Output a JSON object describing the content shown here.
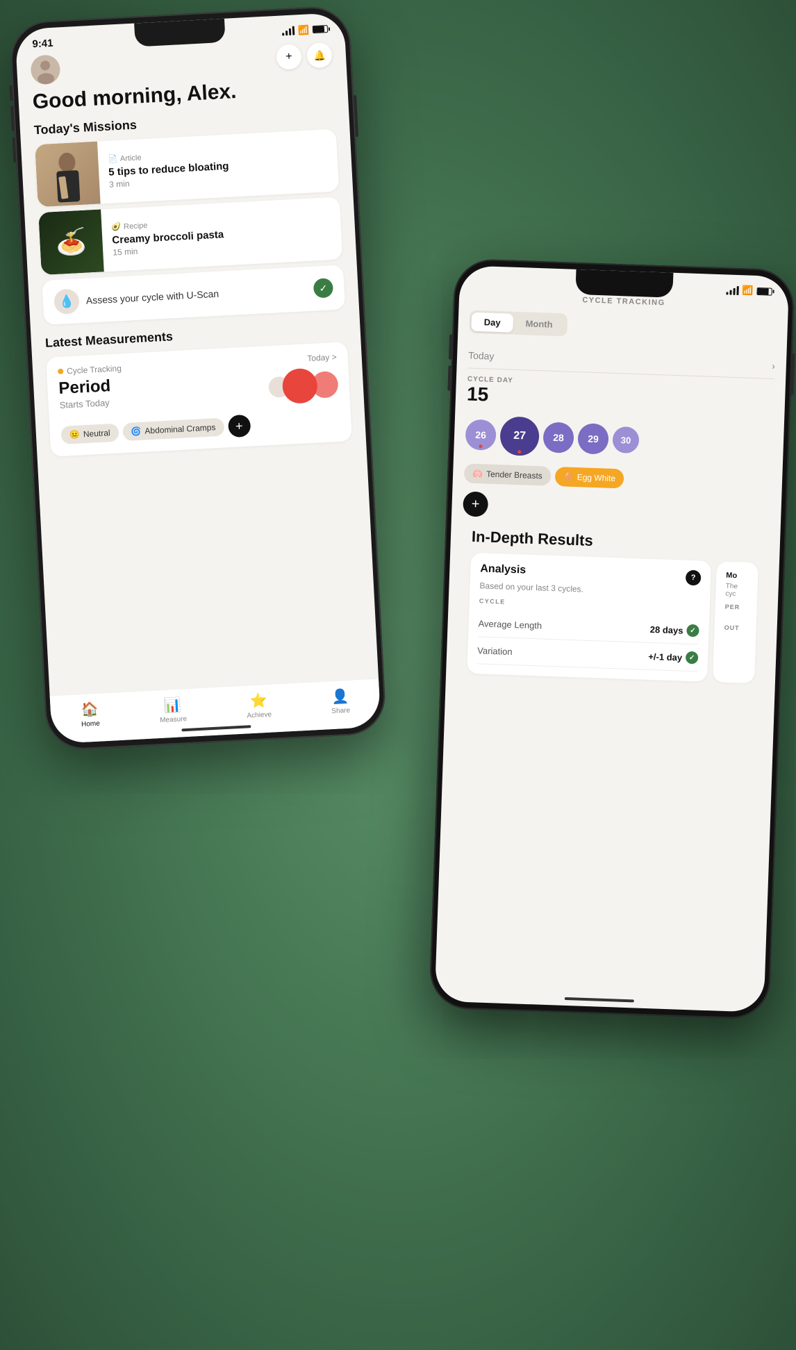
{
  "phone1": {
    "status": {
      "time": "9:41"
    },
    "greeting": "Good morning, Alex.",
    "missions_title": "Today's Missions",
    "missions": [
      {
        "type": "Article",
        "title": "5 tips to reduce bloating",
        "duration": "3 min"
      },
      {
        "type": "Recipe",
        "title": "Creamy broccoli pasta",
        "duration": "15 min"
      }
    ],
    "uscan": {
      "text": "Assess your cycle with U-Scan"
    },
    "measurements_title": "Latest Measurements",
    "measurement": {
      "category": "Cycle Tracking",
      "today_label": "Today >",
      "title": "Period",
      "subtitle": "Starts Today"
    },
    "symptoms": [
      "Neutral",
      "Abdominal Cramps"
    ],
    "nav": [
      "Home",
      "Measure",
      "Achieve",
      "Share"
    ]
  },
  "phone2": {
    "status": {
      "time": ""
    },
    "cycle_tracking_title": "CYCLE TRACKING",
    "tabs": [
      "Day",
      "Month"
    ],
    "active_tab": "Day",
    "today_label": "Today",
    "cycle_day_label": "CYCLE DAY",
    "cycle_day": "15",
    "calendar_days": [
      {
        "day": "26",
        "size": "small"
      },
      {
        "day": "27",
        "size": "large",
        "dot": true
      },
      {
        "day": "28",
        "size": "small"
      },
      {
        "day": "29",
        "size": "small"
      },
      {
        "day": "30",
        "size": "xsmall"
      }
    ],
    "symptoms": [
      "Tender Breasts",
      "Egg White"
    ],
    "in_depth": {
      "title": "In-Depth Results",
      "analysis": {
        "title": "Analysis",
        "subtitle": "Based on your last 3 cycles.",
        "cycle_label": "CYCLE",
        "rows": [
          {
            "label": "Average Length",
            "value": "28 days",
            "check": true
          },
          {
            "label": "Variation",
            "value": "+/-1 day",
            "check": true
          }
        ]
      },
      "mo_label": "Mo",
      "mo_text": "The cyc",
      "per_label": "PER",
      "out_label": "OUT"
    }
  }
}
